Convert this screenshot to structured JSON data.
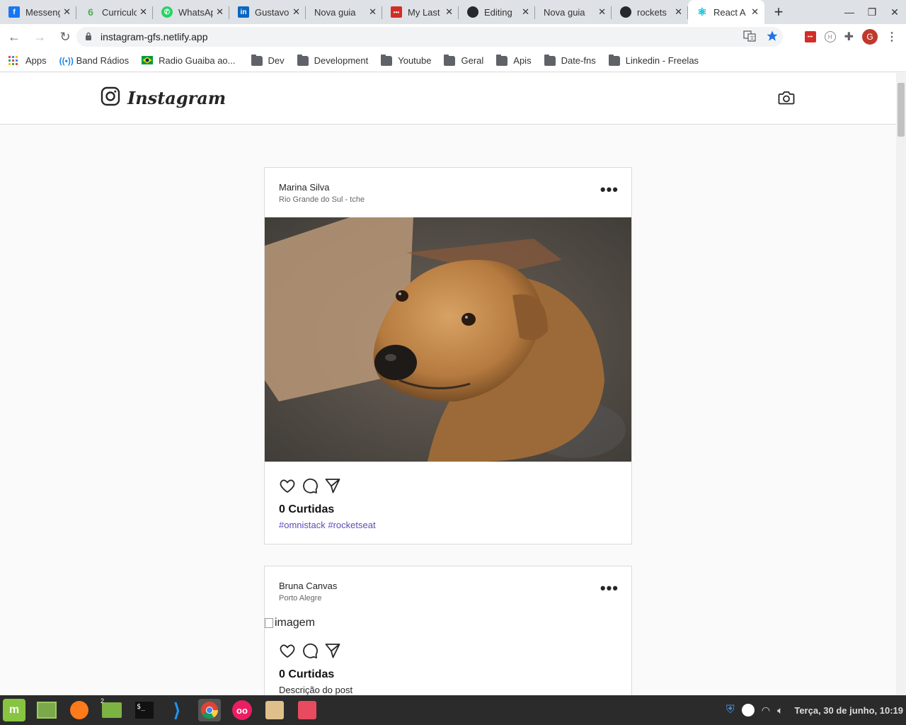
{
  "browser": {
    "tabs": [
      {
        "title": "Messenger",
        "icon": "facebook-icon",
        "color": "#1877f2",
        "glyph": "f"
      },
      {
        "title": "Curriculo",
        "icon": "curriculum-icon",
        "color": "#4caf50",
        "glyph": "6"
      },
      {
        "title": "WhatsApp",
        "icon": "whatsapp-icon",
        "color": "#25d366",
        "glyph": "w"
      },
      {
        "title": "Gustavo",
        "icon": "linkedin-icon",
        "color": "#0a66c2",
        "glyph": "in"
      },
      {
        "title": "Nova guia",
        "icon": "",
        "color": "",
        "glyph": ""
      },
      {
        "title": "My Last",
        "icon": "lastpass-icon",
        "color": "#d32d27",
        "glyph": "•••"
      },
      {
        "title": "Editing",
        "icon": "github-icon",
        "color": "#24292e",
        "glyph": "●"
      },
      {
        "title": "Nova guia",
        "icon": "",
        "color": "",
        "glyph": ""
      },
      {
        "title": "rockets",
        "icon": "github-icon",
        "color": "#24292e",
        "glyph": "●"
      },
      {
        "title": "React A",
        "icon": "react-icon",
        "color": "#00bcd4",
        "glyph": "⚛"
      }
    ],
    "active_tab": 9,
    "url": "instagram-gfs.netlify.app",
    "profile_initial": "G",
    "bookmarks": [
      {
        "label": "Apps",
        "icon": "apps-grid-icon"
      },
      {
        "label": "Band Rádios",
        "icon": "radio-icon"
      },
      {
        "label": "Radio Guaiba ao...",
        "icon": "brazil-flag-icon"
      },
      {
        "label": "Dev",
        "icon": "folder-icon"
      },
      {
        "label": "Development",
        "icon": "folder-icon"
      },
      {
        "label": "Youtube",
        "icon": "folder-icon"
      },
      {
        "label": "Geral",
        "icon": "folder-icon"
      },
      {
        "label": "Apis",
        "icon": "folder-icon"
      },
      {
        "label": "Date-fns",
        "icon": "folder-icon"
      },
      {
        "label": "Linkedin - Freelas",
        "icon": "folder-icon"
      }
    ]
  },
  "app": {
    "logo_text": "Instagram",
    "posts": [
      {
        "author": "Marina Silva",
        "place": "Rio Grande do Sul - tche",
        "image_alt": "imagem",
        "likes": "0 Curtidas",
        "description": "#omnistack #rocketseat"
      },
      {
        "author": "Bruna Canvas",
        "place": "Porto Alegre",
        "image_alt": "imagem",
        "likes": "0 Curtidas",
        "description": "Descrição do post"
      }
    ]
  },
  "taskbar": {
    "clock": "Terça, 30 de junho, 10:19",
    "workspace_badge": "2"
  }
}
